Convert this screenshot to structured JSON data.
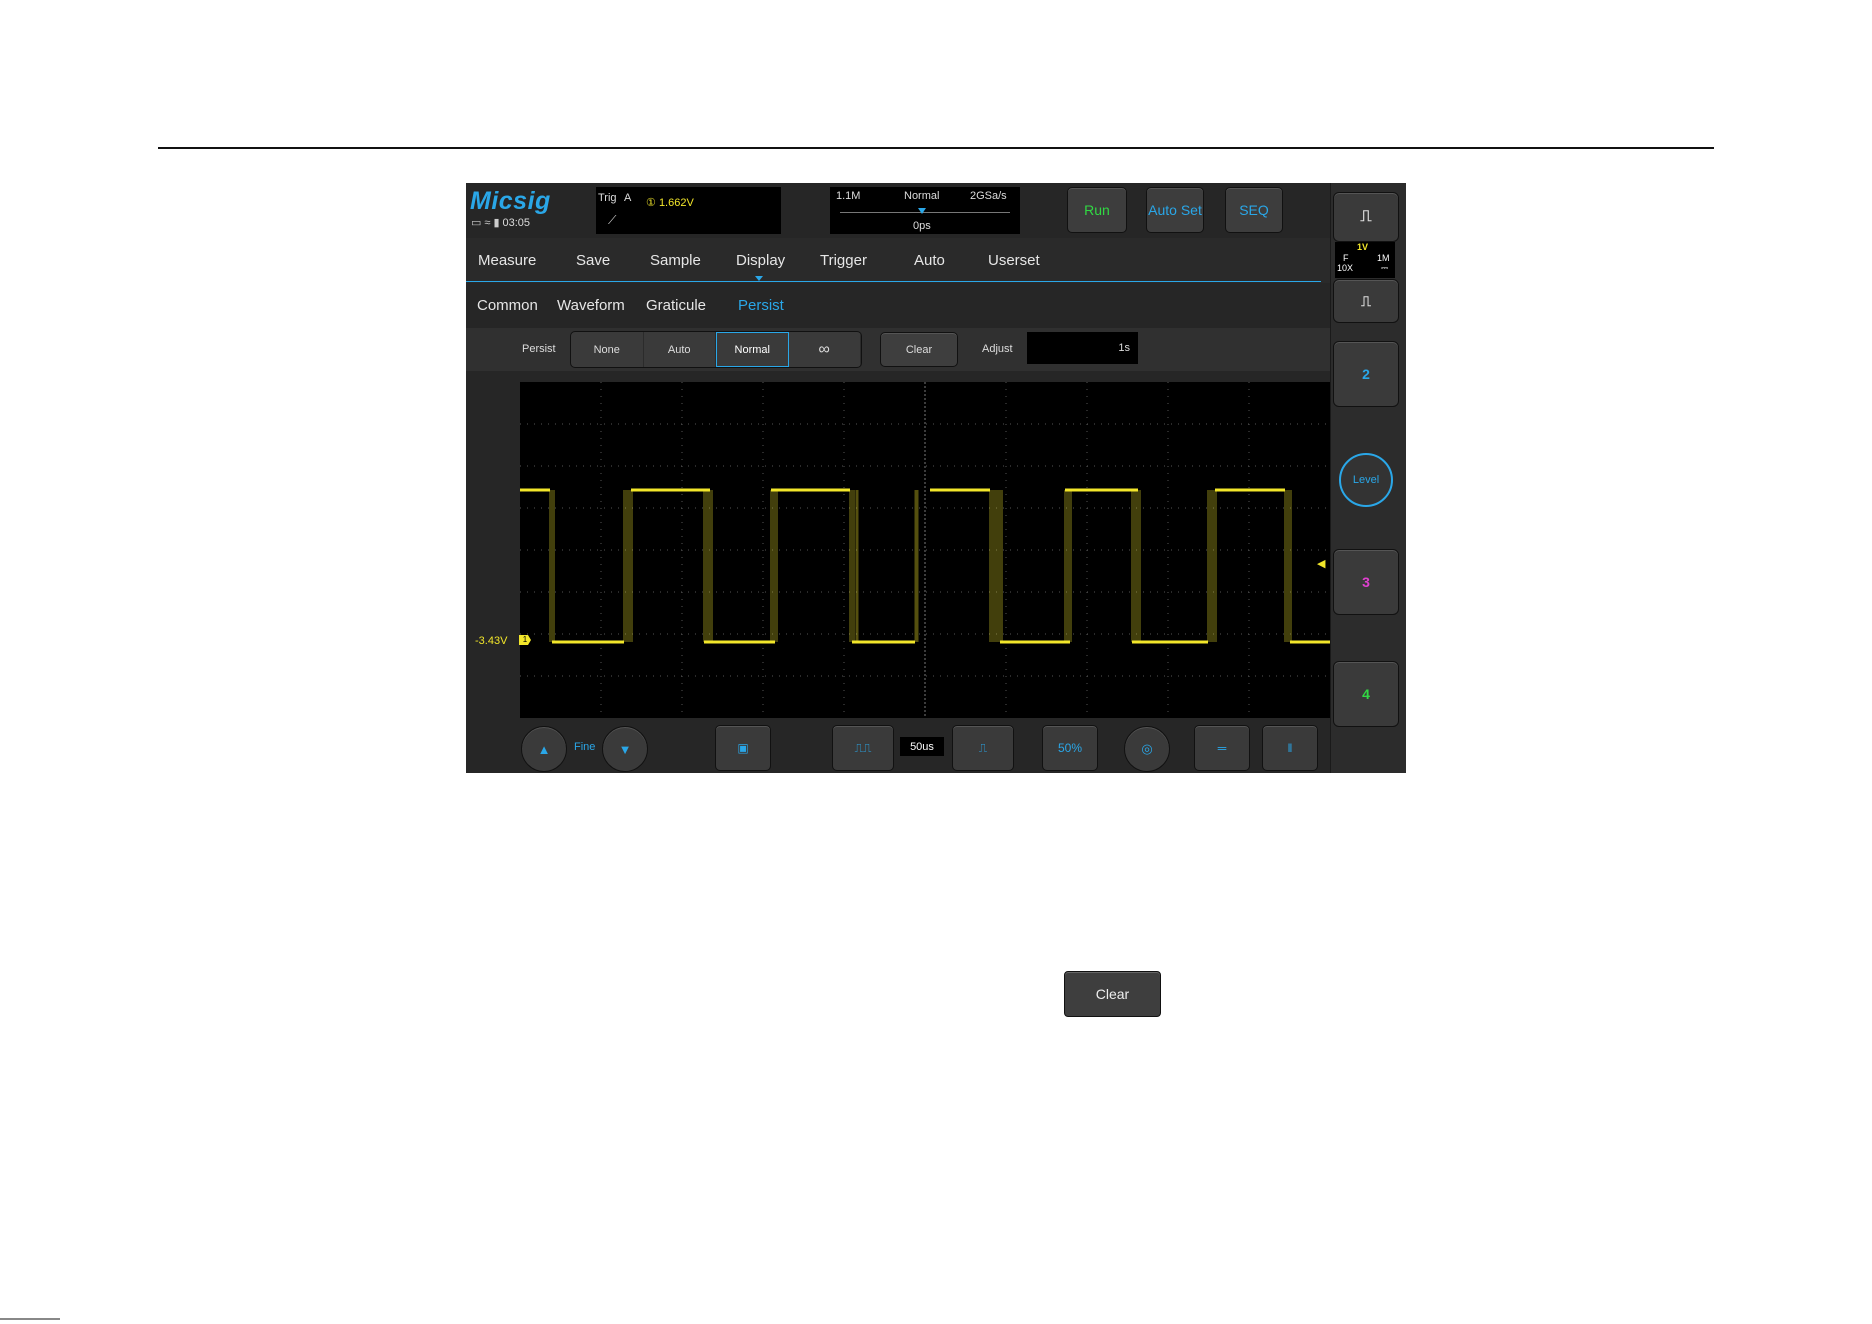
{
  "brand": {
    "logo": "Micsig",
    "time": "03:05"
  },
  "trigger": {
    "label": "Trig",
    "source": "A",
    "channel_mark": "①",
    "level": "1.662V"
  },
  "timebase": {
    "memory": "1.1M",
    "mode": "Normal",
    "sample_rate": "2GSa/s",
    "offset": "0ps"
  },
  "header_buttons": {
    "run": "Run",
    "autoset": "Auto Set",
    "seq": "SEQ"
  },
  "menu": {
    "items": [
      "Measure",
      "Save",
      "Sample",
      "Display",
      "Trigger",
      "Auto",
      "Userset"
    ],
    "active": "Display"
  },
  "submenu": {
    "items": [
      "Common",
      "Waveform",
      "Graticule",
      "Persist"
    ],
    "active": "Persist"
  },
  "persist": {
    "label": "Persist",
    "options": [
      "None",
      "Auto",
      "Normal",
      "∞"
    ],
    "selected": "Normal",
    "clear": "Clear",
    "adjust_label": "Adjust",
    "adjust_value": "1s"
  },
  "waveform": {
    "channel": "1",
    "offset_label": "-3.43V",
    "color": "#f2e62a"
  },
  "bottom": {
    "fine": "Fine",
    "timebase_value": "50us"
  },
  "sidebar": {
    "ch1": {
      "volts": "1V",
      "coupling": "F",
      "impedance": "1M",
      "probe": "10X",
      "dc_icon": "⎓"
    },
    "ch2": "2",
    "level": "Level",
    "ch3": "3",
    "ch4": "4",
    "colors": {
      "ch2": "#2aa7e8",
      "ch3": "#e040d0",
      "ch4": "#31d843"
    }
  },
  "document": {
    "clear_button": "Clear"
  }
}
